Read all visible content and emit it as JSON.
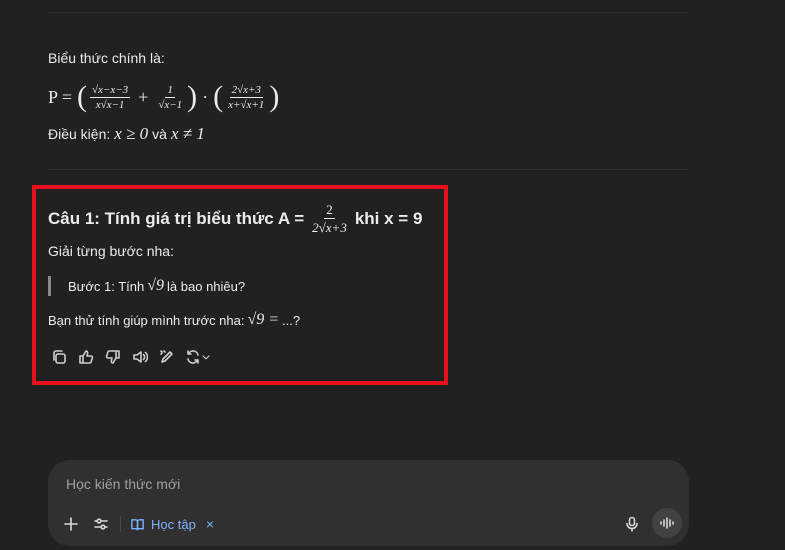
{
  "intro": {
    "line1": "Biểu thức chính là:",
    "formula": {
      "lhs": "P =",
      "frac1_num": "√x−x−3",
      "frac1_den": "x√x−1",
      "plus": "+",
      "frac2_num": "1",
      "frac2_den": "√x−1",
      "dot": "·",
      "frac3_num": "2√x+3",
      "frac3_den": "x+√x+1"
    },
    "condition_label": "Điều kiện:",
    "condition_math1": "x ≥ 0",
    "condition_and": "và",
    "condition_math2": "x ≠ 1"
  },
  "question": {
    "title_before": "Câu 1: Tính giá trị biểu thức A =",
    "frac_num": "2",
    "frac_den": "2√x+3",
    "title_after": "khi x = 9",
    "steps_label": "Giải từng bước nha:",
    "quote_before": "Bước 1: Tính",
    "quote_math": "√9",
    "quote_after": "là bao nhiêu?",
    "try_before": "Bạn thử tính giúp mình trước nha:",
    "try_math": "√9 =",
    "try_after": "...?"
  },
  "actions": [
    "copy-icon",
    "thumbs-up-icon",
    "thumbs-down-icon",
    "speaker-icon",
    "edit-icon",
    "regenerate-icon"
  ],
  "composer": {
    "placeholder": "Học kiến thức mới",
    "chip_label": "Học tập",
    "chip_close": "×"
  },
  "colors": {
    "background": "#212121",
    "highlight": "#e8101b",
    "accent": "#7fb3ff"
  }
}
